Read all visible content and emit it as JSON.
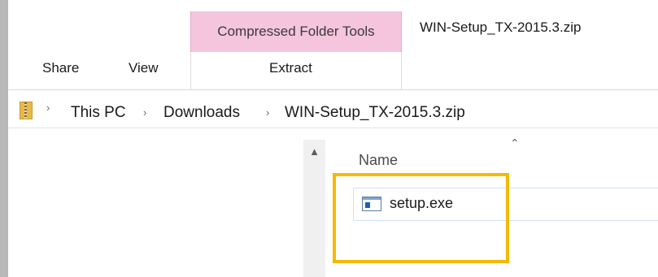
{
  "window": {
    "title": "WIN-Setup_TX-2015.3.zip"
  },
  "ribbon": {
    "contextual_header": "Compressed Folder Tools",
    "tabs": [
      {
        "label": "Share"
      },
      {
        "label": "View"
      },
      {
        "label": "Extract"
      }
    ]
  },
  "address_bar": {
    "breadcrumbs": [
      {
        "label": "This PC"
      },
      {
        "label": "Downloads"
      },
      {
        "label": "WIN-Setup_TX-2015.3.zip"
      }
    ]
  },
  "file_list": {
    "column_header": "Name",
    "items": [
      {
        "name": "setup.exe",
        "icon": "exe-file-icon"
      }
    ]
  },
  "colors": {
    "contextual_tab": "#f5c4dd",
    "highlight": "#f5b800",
    "selection_border": "#cfe3f5"
  }
}
